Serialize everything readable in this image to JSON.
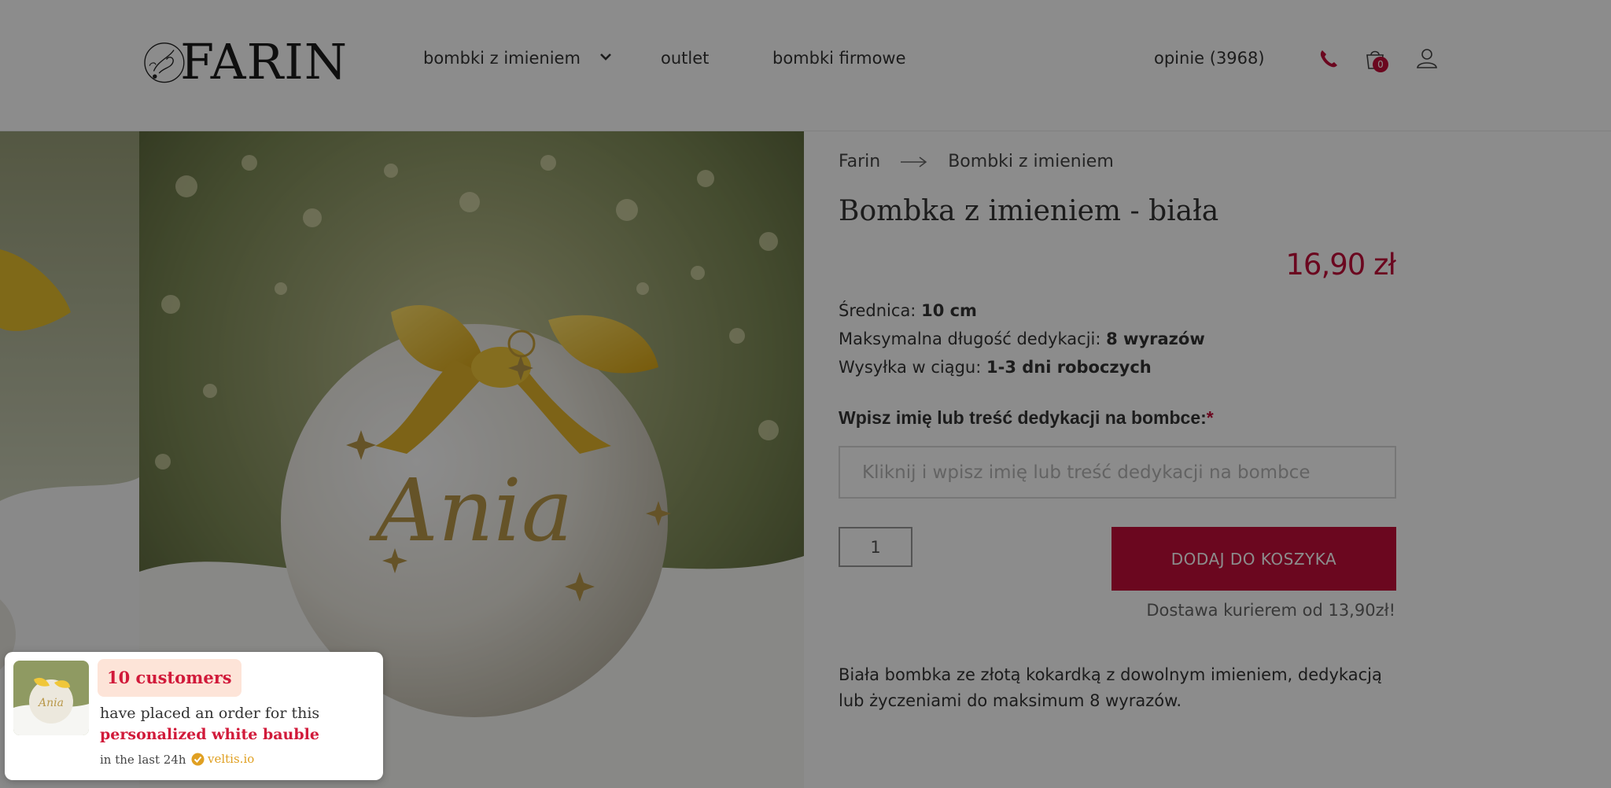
{
  "header": {
    "logo_text": "FARIN",
    "nav": [
      {
        "label": "bombki z imieniem"
      },
      {
        "label": "outlet"
      },
      {
        "label": "bombki firmowe"
      }
    ],
    "opinions": "opinie (3968)",
    "cart_count": "0",
    "icons": [
      "phone-icon",
      "cart-icon",
      "user-icon"
    ]
  },
  "breadcrumb": [
    "Farin",
    "Bombki z imieniem"
  ],
  "product": {
    "title": "Bombka z imieniem - biała",
    "price": "16,90 zł",
    "specs": [
      {
        "label": "Średnica:",
        "value": "10 cm"
      },
      {
        "label": "Maksymalna długość dedykacji:",
        "value": "8 wyrazów"
      },
      {
        "label": "Wysyłka w ciągu:",
        "value": "1-3 dni roboczych"
      }
    ],
    "dedication_label": "Wpisz imię lub treść dedykacji na bombce:",
    "required_mark": "*",
    "dedication_placeholder": "Kliknij i wpisz imię lub treść dedykacji na bombce",
    "quantity": "1",
    "add_to_cart": "DODAJ DO KOSZYKA",
    "delivery": "Dostawa kurierem od 13,90zł!",
    "description": "Biała bombka ze złotą kokardką z dowolnym imieniem, dedykacją lub życzeniami do maksimum 8 wyrazów."
  },
  "image": {
    "ornament_name": "Ania"
  },
  "popup": {
    "badge": "10 customers",
    "line1": "have placed an order for this",
    "line2": "personalized white bauble",
    "time": "in the last 24h",
    "brand": "veltis.io"
  },
  "colors": {
    "accent": "#c30e3a",
    "popup_accent": "#d11a3a",
    "badge_bg": "#fde4d8",
    "brand": "#e0a022"
  }
}
